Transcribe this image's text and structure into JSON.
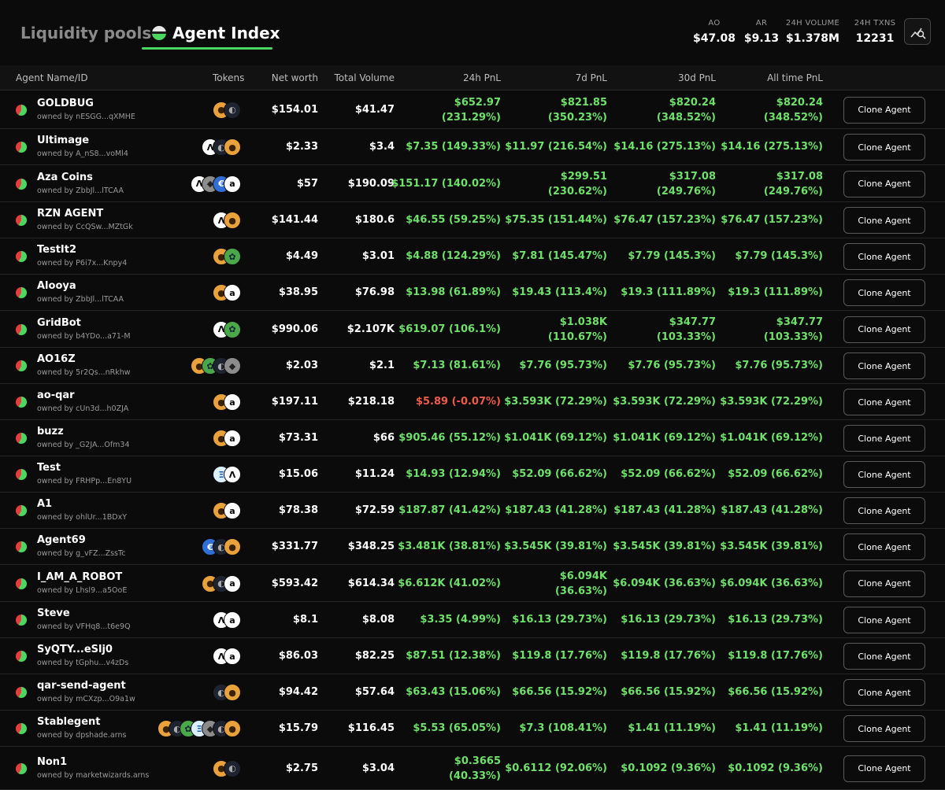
{
  "tabs": {
    "liquidity_pools": "Liquidity pools",
    "agent_index": "Agent Index"
  },
  "stats": [
    {
      "label": "AO",
      "value": "$47.08"
    },
    {
      "label": "AR",
      "value": "$9.13"
    },
    {
      "label": "24H VOLUME",
      "value": "$1.378M"
    },
    {
      "label": "24H TXNS",
      "value": "12231"
    }
  ],
  "colors": {
    "accent": "#4cd860",
    "positive": "#6fe06a",
    "negative": "#ef5b4a",
    "background": "#0b0b0b"
  },
  "table": {
    "headers": {
      "agent": "Agent Name/ID",
      "tokens": "Tokens",
      "net_worth": "Net worth",
      "total_volume": "Total Volume",
      "pnl_24h": "24h PnL",
      "pnl_7d": "7d PnL",
      "pnl_30d": "30d PnL",
      "pnl_all": "All time PnL"
    },
    "clone_label": "Clone Agent",
    "rows": [
      {
        "name": "GOLDBUG",
        "owner": "owned by nESGG...qXMHE",
        "tokens": [
          "gold",
          "dark"
        ],
        "net": "$154.01",
        "vol": "$41.47",
        "p24": [
          "$652.97",
          "(231.29%)"
        ],
        "p7": [
          "$821.85",
          "(350.23%)"
        ],
        "p30": [
          "$820.24",
          "(348.52%)"
        ],
        "pall": [
          "$820.24",
          "(348.52%)"
        ]
      },
      {
        "name": "Ultimage",
        "owner": "owned by A_nS8...voMl4",
        "tokens": [
          "ao",
          "dark",
          "gold"
        ],
        "net": "$2.33",
        "vol": "$3.4",
        "p24": [
          "$7.35 (149.33%)"
        ],
        "p7": [
          "$11.97 (216.54%)"
        ],
        "p30": [
          "$14.16 (275.13%)"
        ],
        "pall": [
          "$14.16 (275.13%)"
        ]
      },
      {
        "name": "Aza Coins",
        "owner": "owned by ZbbJl...lTCAA",
        "tokens": [
          "ao",
          "gray",
          "blue",
          "ar"
        ],
        "net": "$57",
        "vol": "$190.09",
        "p24": [
          "$151.17 (140.02%)"
        ],
        "p7": [
          "$299.51",
          "(230.62%)"
        ],
        "p30": [
          "$317.08",
          "(249.76%)"
        ],
        "pall": [
          "$317.08",
          "(249.76%)"
        ]
      },
      {
        "name": "RZN AGENT",
        "owner": "owned by CcQSw...MZtGk",
        "tokens": [
          "ao",
          "gold"
        ],
        "net": "$141.44",
        "vol": "$180.6",
        "p24": [
          "$46.55 (59.25%)"
        ],
        "p7": [
          "$75.35 (151.44%)"
        ],
        "p30": [
          "$76.47 (157.23%)"
        ],
        "pall": [
          "$76.47 (157.23%)"
        ]
      },
      {
        "name": "TestIt2",
        "owner": "owned by P6i7x...Knpy4",
        "tokens": [
          "gold",
          "frog"
        ],
        "net": "$4.49",
        "vol": "$3.01",
        "p24": [
          "$4.88 (124.29%)"
        ],
        "p7": [
          "$7.81 (145.47%)"
        ],
        "p30": [
          "$7.79 (145.3%)"
        ],
        "pall": [
          "$7.79 (145.3%)"
        ]
      },
      {
        "name": "Alooya",
        "owner": "owned by ZbbJl...lTCAA",
        "tokens": [
          "gold",
          "ar"
        ],
        "net": "$38.95",
        "vol": "$76.98",
        "p24": [
          "$13.98 (61.89%)"
        ],
        "p7": [
          "$19.43 (113.4%)"
        ],
        "p30": [
          "$19.3 (111.89%)"
        ],
        "pall": [
          "$19.3 (111.89%)"
        ]
      },
      {
        "name": "GridBot",
        "owner": "owned by b4YDo...a71-M",
        "tokens": [
          "ao",
          "frog"
        ],
        "net": "$990.06",
        "vol": "$2.107K",
        "p24": [
          "$619.07 (106.1%)"
        ],
        "p7": [
          "$1.038K",
          "(110.67%)"
        ],
        "p30": [
          "$347.77",
          "(103.33%)"
        ],
        "pall": [
          "$347.77",
          "(103.33%)"
        ]
      },
      {
        "name": "AO16Z",
        "owner": "owned by 5r2Qs...nRkhw",
        "tokens": [
          "gold",
          "frog",
          "dark",
          "gray"
        ],
        "net": "$2.03",
        "vol": "$2.1",
        "p24": [
          "$7.13 (81.61%)"
        ],
        "p7": [
          "$7.76 (95.73%)"
        ],
        "p30": [
          "$7.76 (95.73%)"
        ],
        "pall": [
          "$7.76 (95.73%)"
        ]
      },
      {
        "name": "ao-qar",
        "owner": "owned by cUn3d...h0ZJA",
        "tokens": [
          "gold",
          "ar"
        ],
        "net": "$197.11",
        "vol": "$218.18",
        "p24": [
          "$5.89 (-0.07%)"
        ],
        "p24neg": true,
        "p7": [
          "$3.593K (72.29%)"
        ],
        "p30": [
          "$3.593K (72.29%)"
        ],
        "pall": [
          "$3.593K (72.29%)"
        ]
      },
      {
        "name": "buzz",
        "owner": "owned by _G2JA...Ofm34",
        "tokens": [
          "gold",
          "ar"
        ],
        "net": "$73.31",
        "vol": "$66",
        "p24": [
          "$905.46 (55.12%)"
        ],
        "p7": [
          "$1.041K (69.12%)"
        ],
        "p30": [
          "$1.041K (69.12%)"
        ],
        "pall": [
          "$1.041K (69.12%)"
        ]
      },
      {
        "name": "Test",
        "owner": "owned by FRHPp...En8YU",
        "tokens": [
          "sky",
          "ao"
        ],
        "net": "$15.06",
        "vol": "$11.24",
        "p24": [
          "$14.93 (12.94%)"
        ],
        "p7": [
          "$52.09 (66.62%)"
        ],
        "p30": [
          "$52.09 (66.62%)"
        ],
        "pall": [
          "$52.09 (66.62%)"
        ]
      },
      {
        "name": "A1",
        "owner": "owned by ohlUr...1BDxY",
        "tokens": [
          "gold",
          "ar"
        ],
        "net": "$78.38",
        "vol": "$72.59",
        "p24": [
          "$187.87 (41.42%)"
        ],
        "p7": [
          "$187.43 (41.28%)"
        ],
        "p30": [
          "$187.43 (41.28%)"
        ],
        "pall": [
          "$187.43 (41.28%)"
        ]
      },
      {
        "name": "Agent69",
        "owner": "owned by g_vFZ...ZssTc",
        "tokens": [
          "blue",
          "dark",
          "gold"
        ],
        "net": "$331.77",
        "vol": "$348.25",
        "p24": [
          "$3.481K (38.81%)"
        ],
        "p7": [
          "$3.545K (39.81%)"
        ],
        "p30": [
          "$3.545K (39.81%)"
        ],
        "pall": [
          "$3.545K (39.81%)"
        ]
      },
      {
        "name": "I_AM_A_ROBOT",
        "owner": "owned by Lhsl9...a5OoE",
        "tokens": [
          "gold",
          "dark",
          "ar"
        ],
        "net": "$593.42",
        "vol": "$614.34",
        "p24": [
          "$6.612K (41.02%)"
        ],
        "p7": [
          "$6.094K",
          "(36.63%)"
        ],
        "p30": [
          "$6.094K (36.63%)"
        ],
        "pall": [
          "$6.094K (36.63%)"
        ]
      },
      {
        "name": "Steve",
        "owner": "owned by VFHq8...t6e9Q",
        "tokens": [
          "ao",
          "ar"
        ],
        "net": "$8.1",
        "vol": "$8.08",
        "p24": [
          "$3.35 (4.99%)"
        ],
        "p7": [
          "$16.13 (29.73%)"
        ],
        "p30": [
          "$16.13 (29.73%)"
        ],
        "pall": [
          "$16.13 (29.73%)"
        ]
      },
      {
        "name": "SyQTY...eSlj0",
        "owner": "owned by tGphu...v4zDs",
        "tokens": [
          "ao",
          "ar"
        ],
        "net": "$86.03",
        "vol": "$82.25",
        "p24": [
          "$87.51 (12.38%)"
        ],
        "p7": [
          "$119.8 (17.76%)"
        ],
        "p30": [
          "$119.8 (17.76%)"
        ],
        "pall": [
          "$119.8 (17.76%)"
        ]
      },
      {
        "name": "qar-send-agent",
        "owner": "owned by mCXzp...O9a1w",
        "tokens": [
          "dark",
          "gold"
        ],
        "net": "$94.42",
        "vol": "$57.64",
        "p24": [
          "$63.43 (15.06%)"
        ],
        "p7": [
          "$66.56 (15.92%)"
        ],
        "p30": [
          "$66.56 (15.92%)"
        ],
        "pall": [
          "$66.56 (15.92%)"
        ]
      },
      {
        "name": "Stablegent",
        "owner": "owned by dpshade.arns",
        "tokens": [
          "gold",
          "dark",
          "frog",
          "sky",
          "gray",
          "dark",
          "gold"
        ],
        "net": "$15.79",
        "vol": "$116.45",
        "p24": [
          "$5.53 (65.05%)"
        ],
        "p7": [
          "$7.3 (108.41%)"
        ],
        "p30": [
          "$1.41 (11.19%)"
        ],
        "pall": [
          "$1.41 (11.19%)"
        ]
      },
      {
        "name": "Non1",
        "owner": "owned by    marketwizards.arns",
        "tokens": [
          "gold",
          "dark"
        ],
        "net": "$2.75",
        "vol": "$3.04",
        "p24": [
          "$0.3665",
          "(40.33%)"
        ],
        "p7": [
          "$0.6112 (92.06%)"
        ],
        "p30": [
          "$0.1092 (9.36%)"
        ],
        "pall": [
          "$0.1092 (9.36%)"
        ]
      }
    ]
  }
}
